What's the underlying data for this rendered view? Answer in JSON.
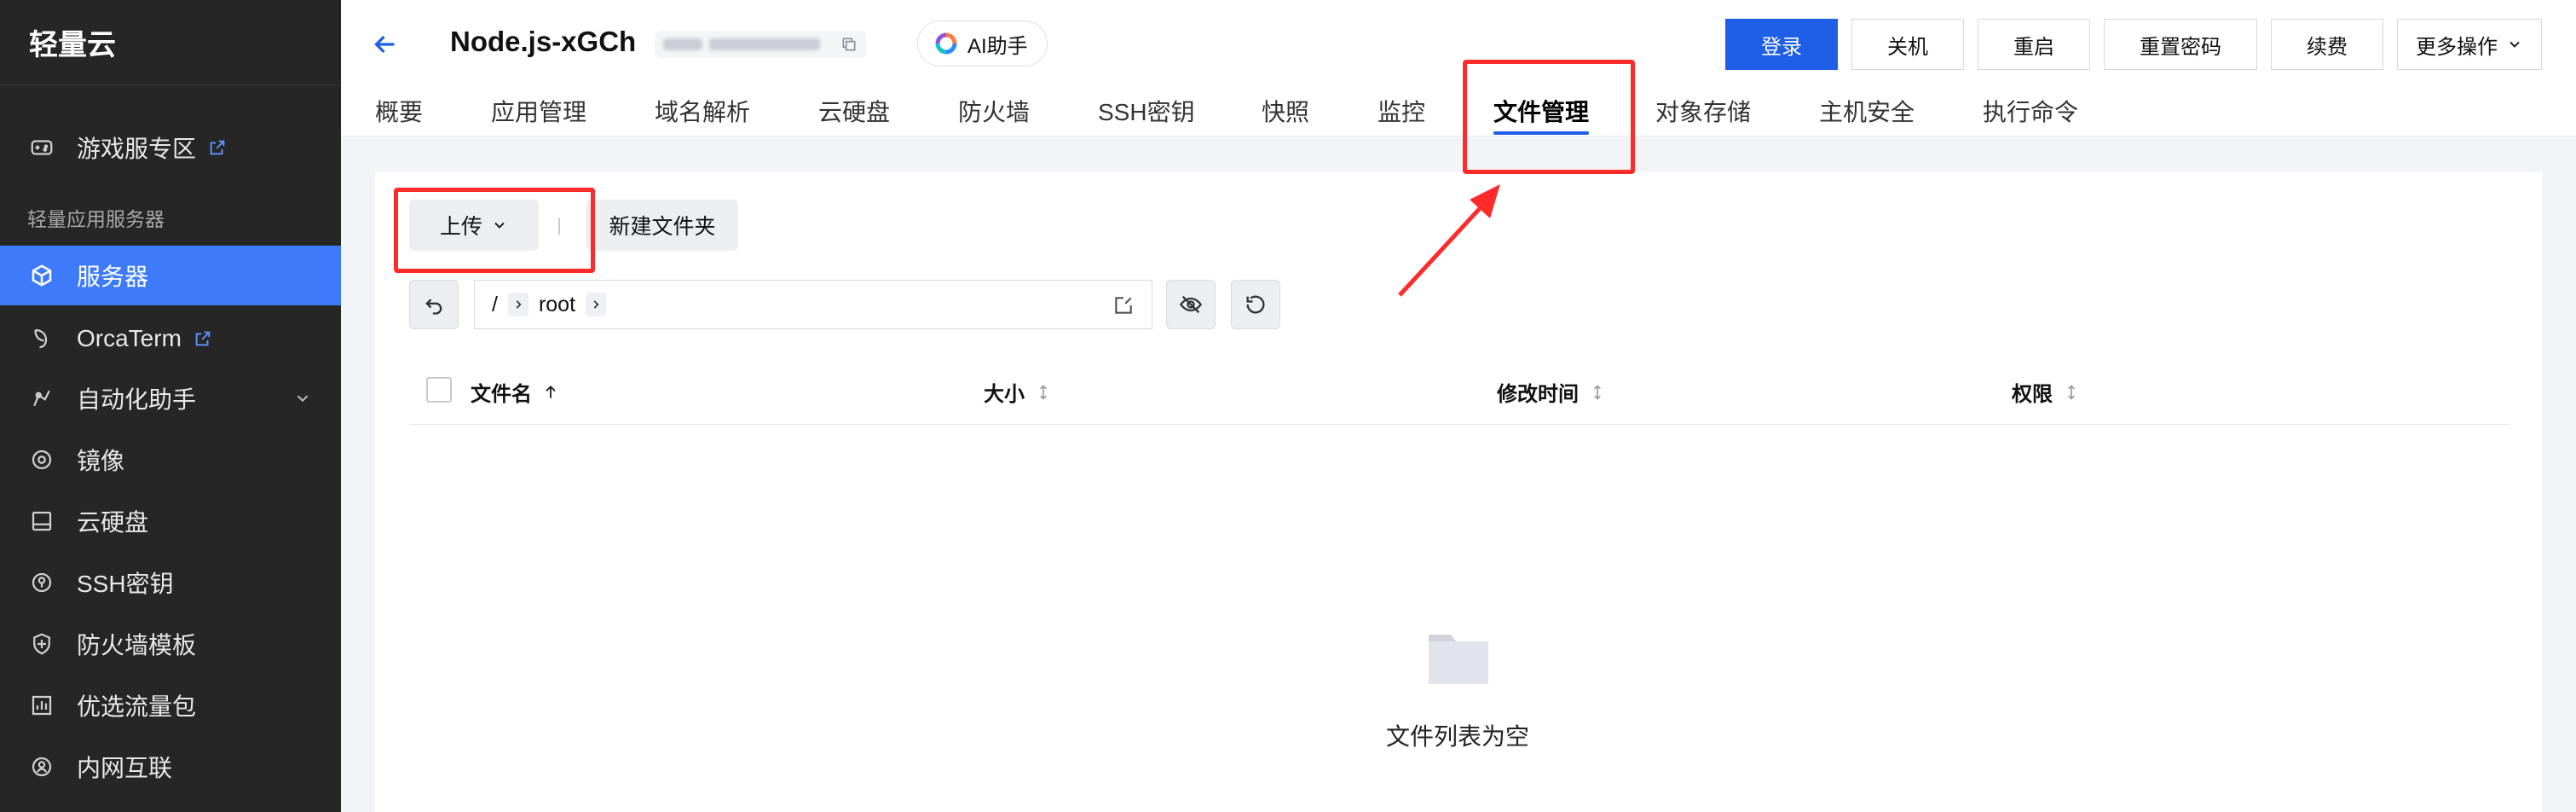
{
  "sidebar": {
    "brand": "轻量云",
    "group_label": "轻量应用服务器",
    "items": [
      {
        "label": "游戏服专区",
        "icon": "gamepad-icon",
        "external": true
      },
      {
        "label": "服务器",
        "icon": "cube-icon",
        "active": true
      },
      {
        "label": "OrcaTerm",
        "icon": "orca-icon",
        "external": true
      },
      {
        "label": "自动化助手",
        "icon": "automation-icon",
        "expandable": true
      },
      {
        "label": "镜像",
        "icon": "image-icon"
      },
      {
        "label": "云硬盘",
        "icon": "disk-icon"
      },
      {
        "label": "SSH密钥",
        "icon": "key-icon"
      },
      {
        "label": "防火墙模板",
        "icon": "shield-icon"
      },
      {
        "label": "优选流量包",
        "icon": "traffic-icon"
      },
      {
        "label": "内网互联",
        "icon": "network-icon"
      }
    ]
  },
  "header": {
    "title": "Node.js-xGCh",
    "ai_button": "AI助手",
    "actions": [
      "登录",
      "关机",
      "重启",
      "重置密码",
      "续费",
      "更多操作"
    ]
  },
  "tabs": [
    "概要",
    "应用管理",
    "域名解析",
    "云硬盘",
    "防火墙",
    "SSH密钥",
    "快照",
    "监控",
    "文件管理",
    "对象存储",
    "主机安全",
    "执行命令"
  ],
  "active_tab": "文件管理",
  "toolbar": {
    "upload": "上传",
    "new_folder": "新建文件夹"
  },
  "path": {
    "root": "/",
    "segment": "root"
  },
  "table": {
    "columns": [
      "文件名",
      "大小",
      "修改时间",
      "权限"
    ]
  },
  "empty_state": "文件列表为空",
  "colors": {
    "sidebar_bg": "#262626",
    "accent": "#3d7bfa",
    "primary_button": "#1f5ee6",
    "annotation": "#ff2b2b"
  }
}
